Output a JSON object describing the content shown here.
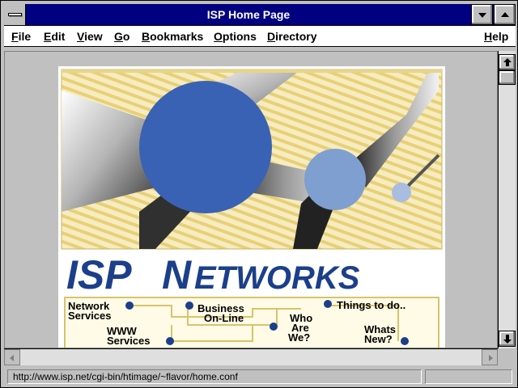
{
  "window": {
    "title": "ISP Home Page"
  },
  "menu": {
    "items": [
      {
        "label": "File"
      },
      {
        "label": "Edit"
      },
      {
        "label": "View"
      },
      {
        "label": "Go"
      },
      {
        "label": "Bookmarks"
      },
      {
        "label": "Options"
      },
      {
        "label": "Directory"
      },
      {
        "label": "Help"
      }
    ]
  },
  "page": {
    "logo": {
      "word1": "ISP",
      "word2_initial": "N",
      "word2_rest": "ETWORKS"
    },
    "nav_links": [
      {
        "line1": "Network",
        "line2": "Services"
      },
      {
        "line1": "Business",
        "line2": "On-Line"
      },
      {
        "line1": "Who",
        "line2": "Are",
        "line3": "We?"
      },
      {
        "line1": "Things to do.."
      },
      {
        "line1": "WWW",
        "line2": "Services"
      },
      {
        "line1": "Whats",
        "line2": "New?"
      }
    ],
    "colors": {
      "logo_blue": "#1b3f8a",
      "sphere_blue": "#3a62b4",
      "sphere_light": "#7f9fd0",
      "background_yellow": "#f2e4a0",
      "nav_dot": "#1b3f8a"
    }
  },
  "status": {
    "url": "http://www.isp.net/cgi-bin/htimage/~flavor/home.conf"
  },
  "icons": {
    "system_menu": "system-menu-icon",
    "minimize": "minimize-icon",
    "maximize": "maximize-icon",
    "scroll_up": "arrow-up-icon",
    "scroll_down": "arrow-down-icon",
    "scroll_left": "arrow-left-icon",
    "scroll_right": "arrow-right-icon"
  }
}
